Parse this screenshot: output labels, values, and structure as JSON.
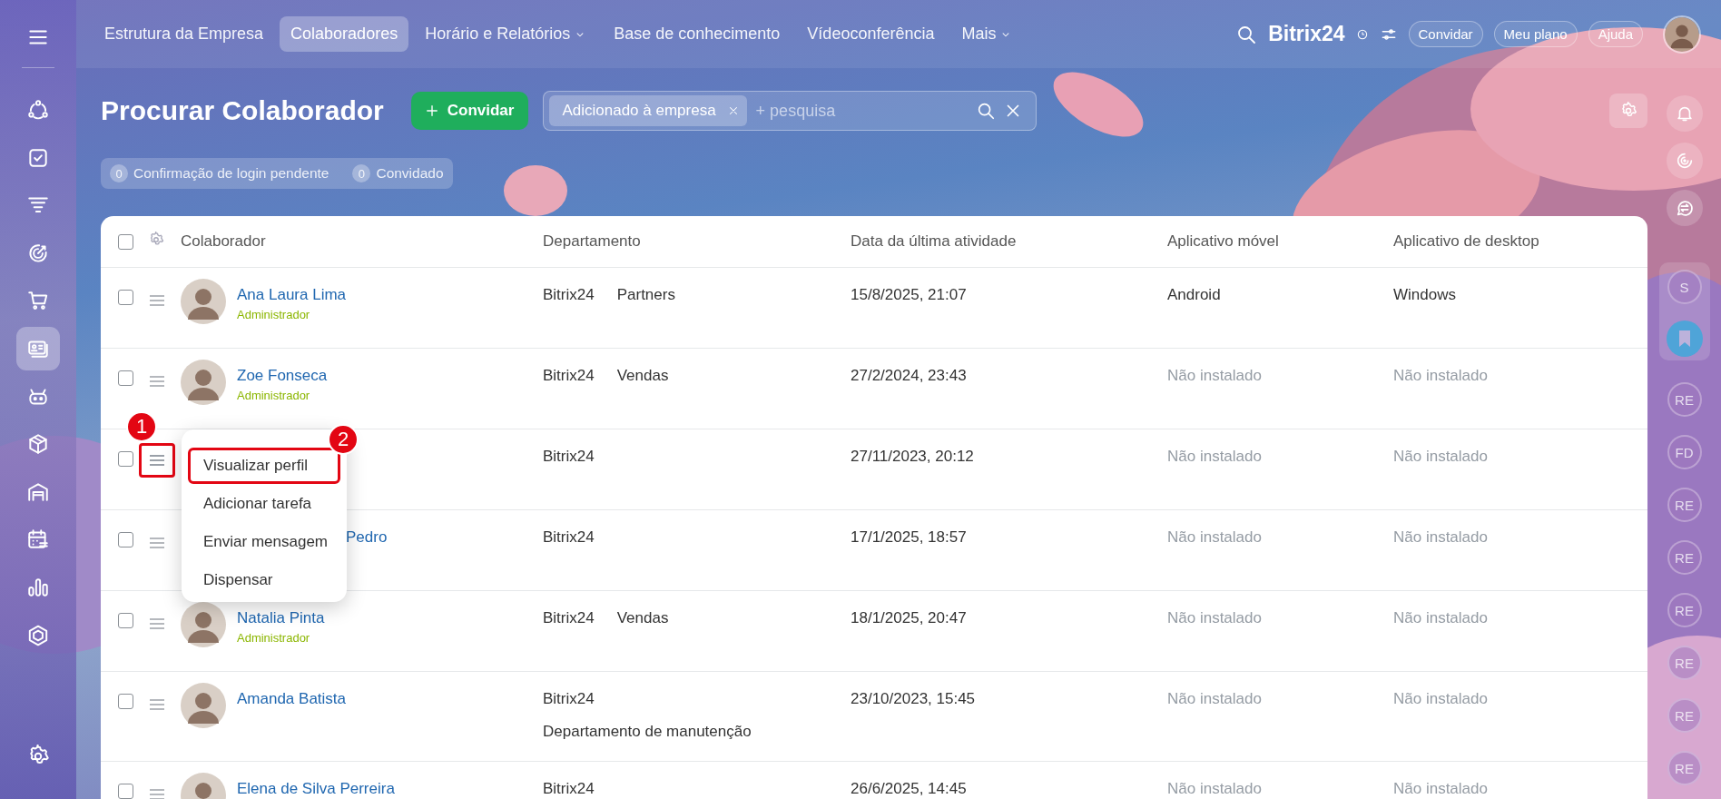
{
  "sidebar": {
    "items": [
      {
        "selected": false
      },
      {
        "selected": false
      },
      {
        "selected": false
      },
      {
        "selected": false
      },
      {
        "selected": false
      },
      {
        "selected": true
      },
      {
        "selected": false
      },
      {
        "selected": false
      },
      {
        "selected": false
      },
      {
        "selected": false
      },
      {
        "selected": false
      },
      {
        "selected": false
      }
    ]
  },
  "top_nav": {
    "items": [
      {
        "label": "Estrutura da Empresa",
        "selected": false,
        "has_menu": false
      },
      {
        "label": "Colaboradores",
        "selected": true,
        "has_menu": false
      },
      {
        "label": "Horário e Relatórios",
        "selected": false,
        "has_menu": true
      },
      {
        "label": "Base de conhecimento",
        "selected": false,
        "has_menu": false
      },
      {
        "label": "Vídeoconferência",
        "selected": false,
        "has_menu": false
      },
      {
        "label": "Mais",
        "selected": false,
        "has_menu": true
      }
    ],
    "logo": "Bitrix24",
    "buttons": [
      "Convidar",
      "Meu plano",
      "Ajuda"
    ]
  },
  "header": {
    "title": "Procurar Colaborador",
    "invite_button": "Convidar",
    "search": {
      "tags": [
        "Adicionado à empresa"
      ],
      "placeholder": "+ pesquisa"
    },
    "counters": [
      {
        "count": "0",
        "label": "Confirmação de login pendente"
      },
      {
        "count": "0",
        "label": "Convidado"
      }
    ]
  },
  "table": {
    "columns": [
      "Colaborador",
      "Departamento",
      "Data da última atividade",
      "Aplicativo móvel",
      "Aplicativo de desktop"
    ],
    "all_checked": false,
    "rows": [
      {
        "kind": "person",
        "checked": false,
        "handle_marked": false,
        "menu_open": false,
        "name": "Ana Laura Lima",
        "role": "Administrador",
        "departments": [
          "Bitrix24",
          "Partners"
        ],
        "last_activity": "15/8/2025, 21:07",
        "mobile_app": {
          "text": "Android",
          "installed": true
        },
        "desktop_app": {
          "text": "Windows",
          "installed": true
        }
      },
      {
        "kind": "person",
        "checked": false,
        "handle_marked": false,
        "menu_open": false,
        "name": "Zoe Fonseca",
        "role": "Administrador",
        "departments": [
          "Bitrix24",
          "Vendas"
        ],
        "last_activity": "27/2/2024, 23:43",
        "mobile_app": {
          "text": "Não instalado",
          "installed": false
        },
        "desktop_app": {
          "text": "Não instalado",
          "installed": false
        }
      },
      {
        "kind": "covered",
        "checked": false,
        "handle_marked": true,
        "marker": "1",
        "menu_open": true,
        "departments": [
          "Bitrix24"
        ],
        "last_activity": "27/11/2023, 20:12",
        "mobile_app": {
          "text": "Não instalado",
          "installed": false
        },
        "desktop_app": {
          "text": "Não instalado",
          "installed": false
        }
      },
      {
        "kind": "covered",
        "checked": false,
        "handle_marked": false,
        "menu_open": false,
        "name": "Pedro",
        "departments": [
          "Bitrix24"
        ],
        "last_activity": "17/1/2025, 18:57",
        "mobile_app": {
          "text": "Não instalado",
          "installed": false
        },
        "desktop_app": {
          "text": "Não instalado",
          "installed": false
        }
      },
      {
        "kind": "person",
        "checked": false,
        "handle_marked": false,
        "menu_open": false,
        "name": "Natalia Pinta",
        "role": "Administrador",
        "departments": [
          "Bitrix24",
          "Vendas"
        ],
        "last_activity": "18/1/2025, 20:47",
        "mobile_app": {
          "text": "Não instalado",
          "installed": false
        },
        "desktop_app": {
          "text": "Não instalado",
          "installed": false
        }
      },
      {
        "kind": "person",
        "checked": false,
        "handle_marked": false,
        "menu_open": false,
        "name": "Amanda Batista",
        "departments": [
          "Bitrix24",
          "Departamento de manutenção"
        ],
        "last_activity": "23/10/2023, 15:45",
        "mobile_app": {
          "text": "Não instalado",
          "installed": false
        },
        "desktop_app": {
          "text": "Não instalado",
          "installed": false
        }
      },
      {
        "kind": "person",
        "checked": false,
        "handle_marked": false,
        "menu_open": false,
        "name": "Elena de Silva Perreira",
        "departments": [
          "Bitrix24"
        ],
        "last_activity": "26/6/2025, 14:45",
        "mobile_app": {
          "text": "Não instalado",
          "installed": false
        },
        "desktop_app": {
          "text": "Não instalado",
          "installed": false
        }
      }
    ]
  },
  "context_menu": {
    "items": [
      {
        "label": "Visualizar perfil",
        "marked": true,
        "marker": "2"
      },
      {
        "label": "Adicionar tarefa",
        "marked": false
      },
      {
        "label": "Enviar mensagem",
        "marked": false
      },
      {
        "label": "Dispensar",
        "marked": false
      }
    ]
  },
  "right_rail": {
    "avatars": [
      "S",
      "RE",
      "FD",
      "RE",
      "RE",
      "RE",
      "RE",
      "RE",
      "RE"
    ]
  }
}
